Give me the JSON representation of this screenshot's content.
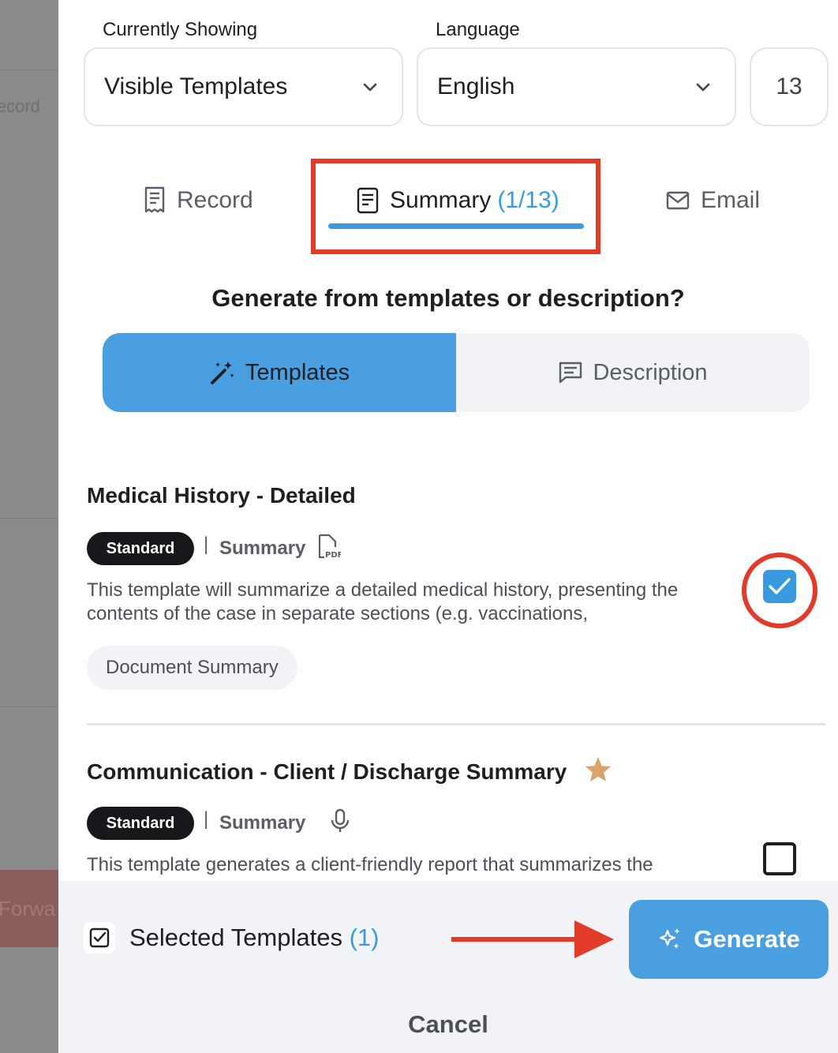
{
  "background": {
    "text1": "Record",
    "text2": "Forwa"
  },
  "filters": {
    "showing_label": "Currently Showing",
    "showing_value": "Visible Templates",
    "language_label": "Language",
    "language_value": "English",
    "count": "13"
  },
  "tabs": [
    {
      "label": "Record",
      "icon": "receipt-icon"
    },
    {
      "label": "Summary",
      "count": "(1/13)",
      "icon": "document-icon"
    },
    {
      "label": "Email",
      "icon": "mail-icon"
    }
  ],
  "question": "Generate from templates or description?",
  "mode_toggle": {
    "templates": "Templates",
    "description": "Description"
  },
  "templates": [
    {
      "title": "Medical History - Detailed",
      "badge": "Standard",
      "separator": "|",
      "type": "Summary",
      "type_icon": "pdf-icon",
      "description_line1": "This template will summarize a detailed medical history, presenting the",
      "description_line2": "contents of the case in separate sections (e.g. vaccinations,",
      "chip": "Document Summary",
      "checked": true
    },
    {
      "title": "Communication - Client / Discharge Summary",
      "favorite": true,
      "badge": "Standard",
      "separator": "|",
      "type": "Summary",
      "type_icon": "microphone-icon",
      "description_line1": "This template generates a client-friendly report that summarizes the",
      "checked": false
    }
  ],
  "footer": {
    "selected_label": "Selected Templates",
    "selected_count": "(1)",
    "generate": "Generate",
    "cancel": "Cancel"
  },
  "colors": {
    "accent": "#3a9ae0",
    "annotation": "#e23b2a",
    "star": "#d9a36a"
  }
}
